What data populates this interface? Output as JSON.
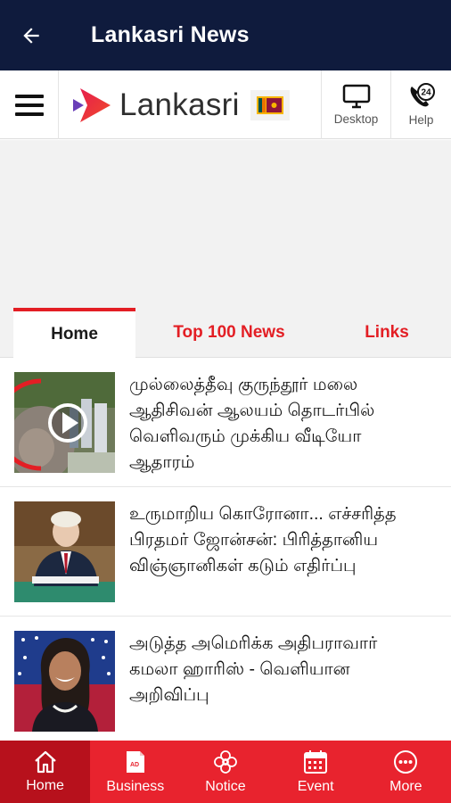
{
  "appbar": {
    "title": "Lankasri News"
  },
  "header": {
    "brand": "Lankasri",
    "desktop_label": "Desktop",
    "help_label": "Help",
    "help_badge": "24"
  },
  "tabs": [
    {
      "label": "Home"
    },
    {
      "label": "Top 100 News"
    },
    {
      "label": "Links"
    }
  ],
  "news": [
    {
      "title": "முல்லைத்தீவு குருந்தூர் மலை ஆதிசிவன் ஆலயம் தொடர்பில் வெளிவரும் முக்கிய வீடியோ ஆதாரம்"
    },
    {
      "title": "உருமாறிய கொரோனா... எச்சரித்த பிரதமர் ஜோன்சன்: பிரித்தானிய விஞ்ஞானிகள் கடும் எதிர்ப்பு"
    },
    {
      "title": "அடுத்த அமெரிக்க அதிபராவார் கமலா ஹாரிஸ் - வெளியான அறிவிப்பு"
    }
  ],
  "bottom_nav": [
    {
      "label": "Home"
    },
    {
      "label": "Business"
    },
    {
      "label": "Notice"
    },
    {
      "label": "Event"
    },
    {
      "label": "More"
    }
  ],
  "colors": {
    "appbar": "#0f1b3d",
    "accent": "#e31e24",
    "nav_bg": "#e8232e",
    "nav_active": "#b7111c"
  }
}
